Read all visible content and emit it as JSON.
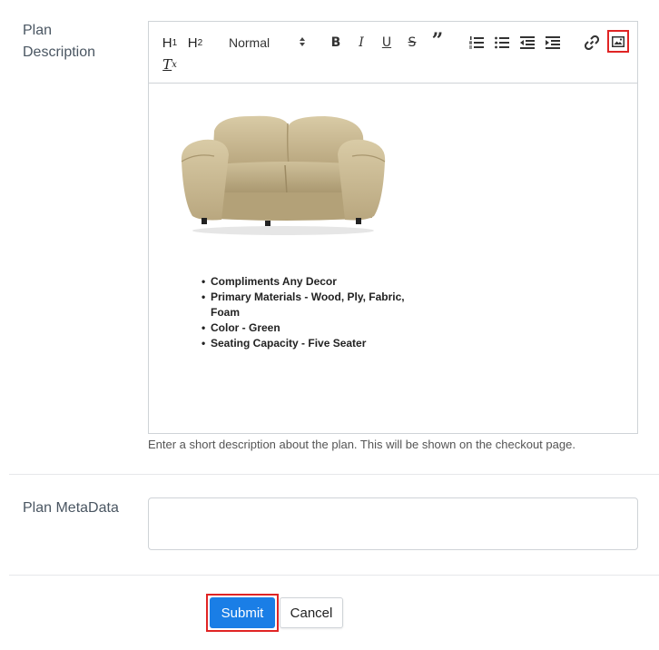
{
  "form": {
    "plan_description_label": "Plan Description",
    "plan_metadata_label": "Plan MetaData",
    "help_text": "Enter a short description about the plan. This will be shown on the checkout page.",
    "metadata_value": ""
  },
  "toolbar": {
    "h1": "H",
    "h1_sub": "1",
    "h2": "H",
    "h2_sub": "2",
    "format_select": "Normal",
    "bold": "B",
    "italic": "I",
    "underline": "U",
    "strike": "S",
    "quote": "”",
    "clear_format": "T",
    "clear_format_sub": "x"
  },
  "editor": {
    "bullets": [
      "Compliments Any Decor",
      "Primary Materials - Wood, Ply, Fabric, Foam",
      "Color - Green",
      "Seating Capacity - Five Seater"
    ]
  },
  "buttons": {
    "submit": "Submit",
    "cancel": "Cancel"
  },
  "colors": {
    "primary": "#1a7ee6",
    "highlight": "#e02424",
    "border": "#cfd3d7"
  }
}
